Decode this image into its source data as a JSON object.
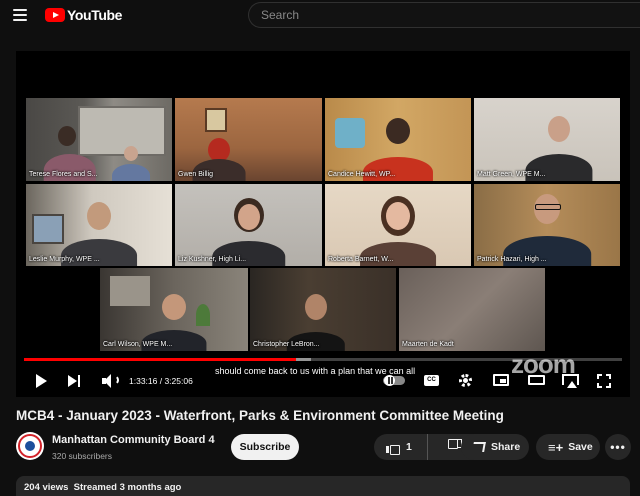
{
  "header": {
    "logo_text": "YouTube",
    "search_placeholder": "Search"
  },
  "player": {
    "participants": [
      {
        "name": "Terese Flores and S..."
      },
      {
        "name": "Gwen Billig"
      },
      {
        "name": "Candice Hewitt, WP..."
      },
      {
        "name": "Matt Green, WPE M..."
      },
      {
        "name": "Leslie Murphy, WPE ..."
      },
      {
        "name": "Liz Kushner, High Li..."
      },
      {
        "name": "Roberta Barnett, W..."
      },
      {
        "name": "Patrick Hazari, High ..."
      },
      {
        "name": "Carl Wilson, WPE M..."
      },
      {
        "name": "Christopher LeBron..."
      },
      {
        "name": "Maarten de Kadt"
      }
    ],
    "active_speaker_color": "#3fd34a",
    "caption": "should come back to us with a plan that we can all",
    "watermark": "zoom",
    "time_current": "1:33:16",
    "time_total": "3:25:06",
    "time_display": "1:33:16 / 3:25:06",
    "progress_fraction": 0.455,
    "buffered_fraction": 0.48,
    "cc_label": "CC",
    "progress_color": "#ff0000"
  },
  "video": {
    "title": "MCB4 - January 2023 - Waterfront, Parks & Environment Committee Meeting",
    "channel_name": "Manhattan Community Board 4",
    "subscribers": "320 subscribers",
    "subscribe_label": "Subscribe",
    "likes": "1",
    "share_label": "Share",
    "save_label": "Save",
    "more_label": "•••",
    "views": "204 views",
    "streamed": "Streamed 3 months ago",
    "meta_line": "204 views  Streamed 3 months ago"
  },
  "icons": [
    "menu-icon",
    "youtube-logo-icon",
    "play-icon",
    "next-icon",
    "volume-icon",
    "autoplay-toggle",
    "cc-icon",
    "settings-icon",
    "miniplayer-icon",
    "theater-icon",
    "airplay-icon",
    "fullscreen-icon",
    "like-icon",
    "dislike-icon",
    "share-icon",
    "save-icon"
  ]
}
